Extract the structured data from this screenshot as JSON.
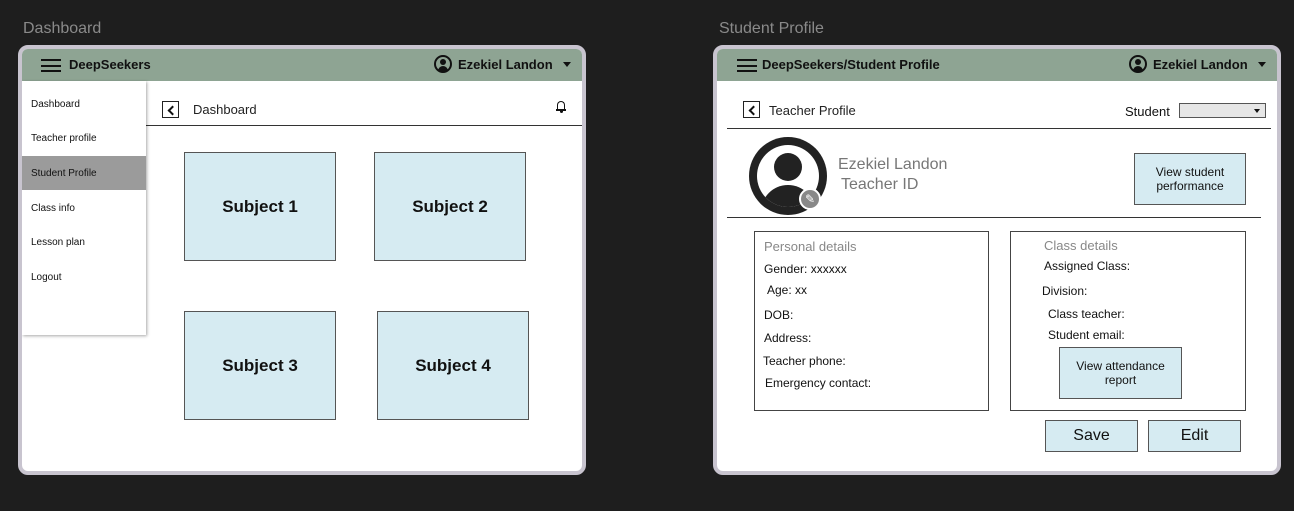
{
  "dashboard": {
    "frame_label": "Dashboard",
    "topbar": {
      "brand": "DeepSeekers",
      "user_name": "Ezekiel Landon"
    },
    "sidebar": {
      "items": [
        {
          "label": "Dashboard",
          "active": false
        },
        {
          "label": "Teacher profile",
          "active": false
        },
        {
          "label": "Student Profile",
          "active": true
        },
        {
          "label": "Class info",
          "active": false
        },
        {
          "label": "Lesson plan",
          "active": false
        },
        {
          "label": "Logout",
          "active": false
        }
      ]
    },
    "breadcrumb": "Dashboard",
    "subjects": [
      "Subject 1",
      "Subject 2",
      "Subject 3",
      "Subject 4"
    ]
  },
  "profile": {
    "frame_label": "Student Profile",
    "topbar": {
      "brand": "DeepSeekers/Student Profile",
      "user_name": "Ezekiel Landon"
    },
    "breadcrumb": "Teacher Profile",
    "student_label": "Student",
    "student_select_value": "",
    "name": "Ezekiel Landon",
    "teacher_id": "Teacher ID",
    "view_performance_label": "View student performance",
    "personal_details": {
      "heading": "Personal details",
      "fields": [
        "Gender: xxxxxx",
        "Age: xx",
        "DOB:",
        "Address:",
        "Teacher phone:",
        "Emergency contact:"
      ]
    },
    "class_details": {
      "heading": "Class details",
      "fields": [
        "Assigned Class:",
        "Division:",
        "Class teacher:",
        "Student email:"
      ]
    },
    "view_attendance_label": "View attendance report",
    "save_label": "Save",
    "edit_label": "Edit"
  },
  "colors": {
    "topbar": "#8ea493",
    "tile": "#d6ebf2",
    "active_sidebar": "#9b9b9b",
    "background": "#1e1e1e"
  }
}
